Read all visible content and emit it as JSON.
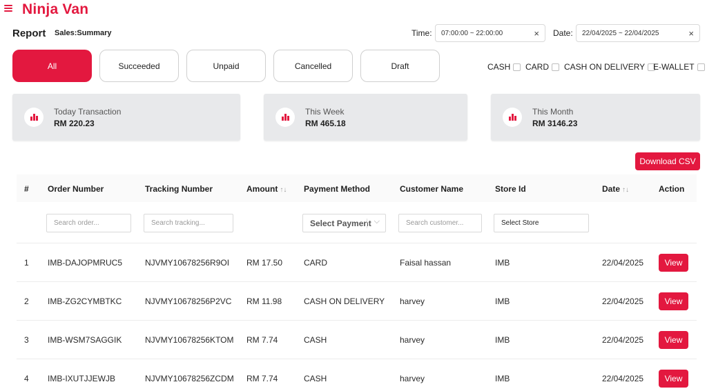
{
  "app": {
    "brand": "Ninja Van"
  },
  "page": {
    "title": "Report",
    "subtitle": "Sales:Summary"
  },
  "filters": {
    "time_label": "Time:",
    "time_value": "07:00:00 ~ 22:00:00",
    "date_label": "Date:",
    "date_value": "22/04/2025 ~ 22/04/2025",
    "clear_glyph": "×"
  },
  "tabs": [
    {
      "label": "All",
      "active": true
    },
    {
      "label": "Succeeded",
      "active": false
    },
    {
      "label": "Unpaid",
      "active": false
    },
    {
      "label": "Cancelled",
      "active": false
    },
    {
      "label": "Draft",
      "active": false
    }
  ],
  "payment_filters": [
    "CASH",
    "CARD",
    "CASH ON DELIVERY",
    "E-WALLET"
  ],
  "cards": [
    {
      "label": "Today Transaction",
      "amount": "RM 220.23",
      "icon": "bar-chart-icon"
    },
    {
      "label": "This Week",
      "amount": "RM 465.18",
      "icon": "bar-chart-icon"
    },
    {
      "label": "This Month",
      "amount": "RM 3146.23",
      "icon": "bar-chart-icon"
    }
  ],
  "download_label": "Download CSV",
  "table": {
    "columns": [
      "#",
      "Order Number",
      "Tracking Number",
      "Amount",
      "Payment Method",
      "Customer Name",
      "Store Id",
      "Date",
      "Action"
    ],
    "sort_glyph": "↑↓",
    "filters": {
      "order_placeholder": "Search order...",
      "tracking_placeholder": "Search tracking...",
      "payment_select": "Select Payment",
      "customer_placeholder": "Search customer...",
      "store_select": "Select Store"
    },
    "rows": [
      {
        "idx": "1",
        "order": "IMB-DAJOPMRUC5",
        "tracking": "NJVMY10678256R9OI",
        "amount": "RM 17.50",
        "method": "CARD",
        "customer": "Faisal hassan",
        "store": "IMB",
        "date": "22/04/2025",
        "action": "View"
      },
      {
        "idx": "2",
        "order": "IMB-ZG2CYMBTKC",
        "tracking": "NJVMY10678256P2VC",
        "amount": "RM 11.98",
        "method": "CASH ON DELIVERY",
        "customer": "harvey",
        "store": "IMB",
        "date": "22/04/2025",
        "action": "View"
      },
      {
        "idx": "3",
        "order": "IMB-WSM7SAGGIK",
        "tracking": "NJVMY10678256KTOM",
        "amount": "RM 7.74",
        "method": "CASH",
        "customer": "harvey",
        "store": "IMB",
        "date": "22/04/2025",
        "action": "View"
      },
      {
        "idx": "4",
        "order": "IMB-IXUTJJEWJB",
        "tracking": "NJVMY10678256ZCDM",
        "amount": "RM 7.74",
        "method": "CASH",
        "customer": "harvey",
        "store": "IMB",
        "date": "22/04/2025",
        "action": "View"
      }
    ]
  },
  "colors": {
    "brand": "#e3183f",
    "card_bg": "#e8e9eb"
  }
}
